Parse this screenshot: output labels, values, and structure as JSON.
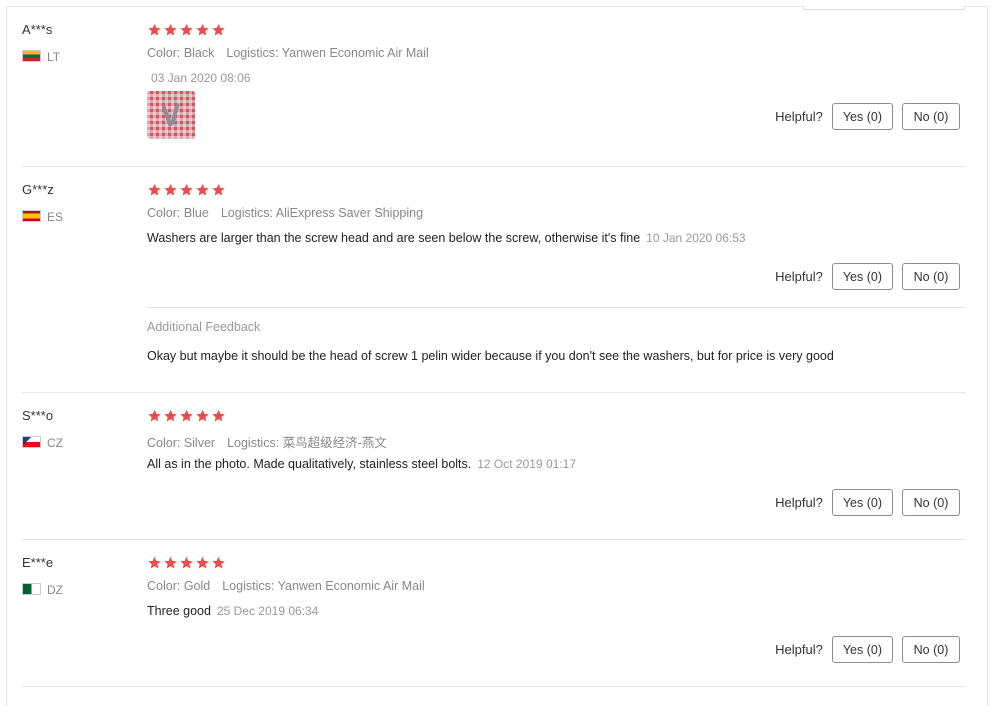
{
  "colors": {
    "star": "#f24b4b",
    "border": "#e5e5e5",
    "muted": "#888888"
  },
  "reviews": [
    {
      "user": "A***s",
      "country": "LT",
      "flag": "lithuania-flag-icon",
      "rating": 5,
      "color": "Color: Black",
      "logistics": "Logistics: Yanwen Economic Air Mail",
      "text": "",
      "date": "03 Jan 2020 08:06",
      "has_photo": true,
      "helpful_label": "Helpful?",
      "yes_label": "Yes (0)",
      "no_label": "No (0)"
    },
    {
      "user": "G***z",
      "country": "ES",
      "flag": "spain-flag-icon",
      "rating": 5,
      "color": "Color: Blue",
      "logistics": "Logistics: AliExpress Saver Shipping",
      "text": "Washers are larger than the screw head and are seen below the screw, otherwise it's fine",
      "date": "10 Jan 2020 06:53",
      "helpful_label": "Helpful?",
      "yes_label": "Yes (0)",
      "no_label": "No (0)",
      "additional_title": "Additional Feedback",
      "additional_text": "Okay but maybe it should be the head of screw 1 pelin wider because if you don't see the washers, but for price is very good"
    },
    {
      "user": "S***o",
      "country": "CZ",
      "flag": "czech-flag-icon",
      "rating": 5,
      "color": "Color: Silver",
      "logistics": "Logistics: 菜鸟超级经济-燕文",
      "text": "All as in the photo. Made qualitatively, stainless steel bolts.",
      "date": "12 Oct 2019 01:17",
      "helpful_label": "Helpful?",
      "yes_label": "Yes (0)",
      "no_label": "No (0)"
    },
    {
      "user": "E***e",
      "country": "DZ",
      "flag": "algeria-flag-icon",
      "rating": 5,
      "color": "Color: Gold",
      "logistics": "Logistics: Yanwen Economic Air Mail",
      "text": "Three good",
      "date": "25 Dec 2019 06:34",
      "helpful_label": "Helpful?",
      "yes_label": "Yes (0)",
      "no_label": "No (0)"
    }
  ]
}
